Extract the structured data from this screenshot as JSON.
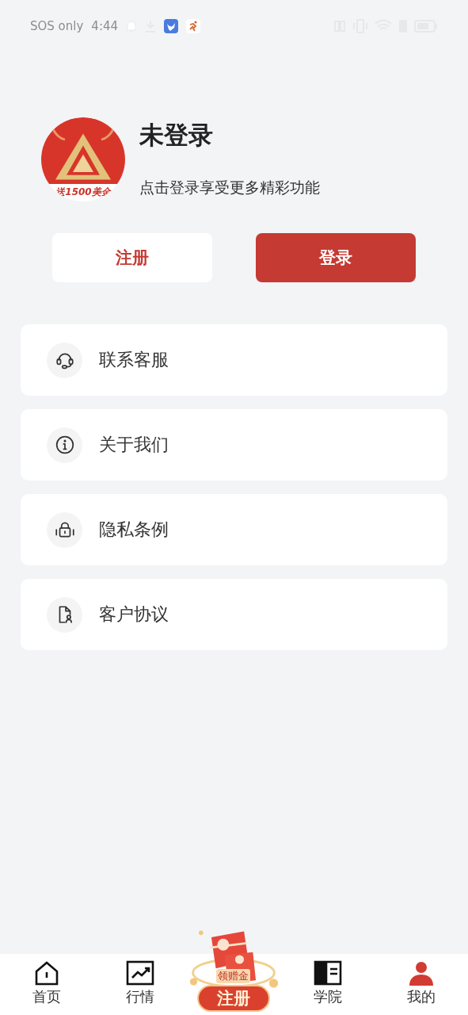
{
  "status_bar": {
    "carrier": "SOS only",
    "time": "4:44"
  },
  "profile": {
    "avatar_caption": "送1500美金",
    "title": "未登录",
    "subtitle": "点击登录享受更多精彩功能"
  },
  "buttons": [
    {
      "kind": "outline",
      "label": "注册"
    },
    {
      "kind": "primary",
      "label": "登录"
    }
  ],
  "menu": [
    {
      "kind": "headset",
      "label": "联系客服"
    },
    {
      "kind": "info",
      "label": "关于我们"
    },
    {
      "kind": "lock",
      "label": "隐私条例"
    },
    {
      "kind": "document",
      "label": "客户协议"
    }
  ],
  "promo": {
    "caption": "领赠金",
    "label": "注册"
  },
  "tabs": [
    {
      "kind": "home",
      "label": "首页",
      "selected": false
    },
    {
      "kind": "chart",
      "label": "行情",
      "selected": false
    },
    {
      "kind": "promo"
    },
    {
      "kind": "book",
      "label": "学院",
      "selected": false
    },
    {
      "kind": "person",
      "label": "我的",
      "selected": true
    }
  ]
}
